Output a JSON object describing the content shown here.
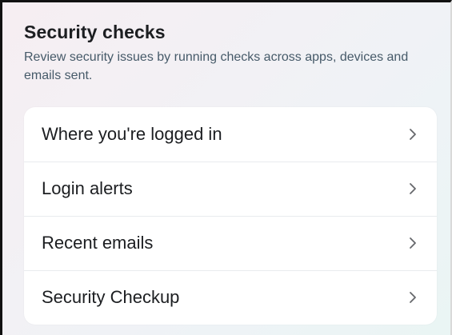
{
  "security_checks": {
    "title": "Security checks",
    "subtitle": "Review security issues by running checks across apps, devices and emails sent.",
    "items": [
      {
        "label": "Where you're logged in",
        "icon": "chevron-right-icon"
      },
      {
        "label": "Login alerts",
        "icon": "chevron-right-icon"
      },
      {
        "label": "Recent emails",
        "icon": "chevron-right-icon"
      },
      {
        "label": "Security Checkup",
        "icon": "chevron-right-icon"
      }
    ]
  },
  "colors": {
    "title": "#1c1e21",
    "subtitle": "#465a69",
    "card_background": "#ffffff",
    "divider": "#e9ebee",
    "chevron": "#65676b"
  }
}
